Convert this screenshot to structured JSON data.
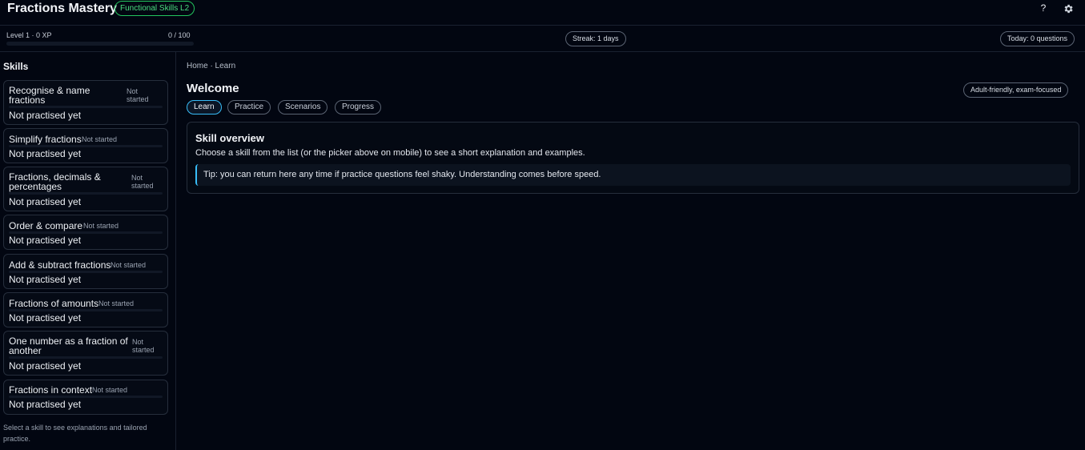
{
  "header": {
    "title": "Fractions Mastery",
    "badge": "Functional Skills L2",
    "help_glyph": "?",
    "help_icon": "help-icon",
    "settings_icon": "gear-icon"
  },
  "status": {
    "level_text": "Level 1 · 0 XP",
    "xp_text": "0 / 100",
    "xp_progress": 0,
    "streak": "Streak: 1 days",
    "today": "Today: 0 questions"
  },
  "sidebar": {
    "heading": "Skills",
    "skills": [
      {
        "name_lines": [
          "Recognise & name",
          "fractions"
        ],
        "status_lines": [
          "Not",
          "started"
        ],
        "practised": "Not practised yet",
        "progress": 0
      },
      {
        "name_lines": [
          "Simplify fractions"
        ],
        "status_lines": [
          "Not started"
        ],
        "practised": "Not practised yet",
        "progress": 0
      },
      {
        "name_lines": [
          "Fractions, decimals &",
          "percentages"
        ],
        "status_lines": [
          "Not",
          "started"
        ],
        "practised": "Not practised yet",
        "progress": 0
      },
      {
        "name_lines": [
          "Order & compare"
        ],
        "status_lines": [
          "Not started"
        ],
        "practised": "Not practised yet",
        "progress": 0
      },
      {
        "name_lines": [
          "Add & subtract fractions"
        ],
        "status_lines": [
          "Not started"
        ],
        "practised": "Not practised yet",
        "progress": 0
      },
      {
        "name_lines": [
          "Fractions of amounts"
        ],
        "status_lines": [
          "Not started"
        ],
        "practised": "Not practised yet",
        "progress": 0
      },
      {
        "name_lines": [
          "One number as a fraction of",
          "another"
        ],
        "status_lines": [
          "Not",
          "started"
        ],
        "practised": "Not practised yet",
        "progress": 0
      },
      {
        "name_lines": [
          "Fractions in context"
        ],
        "status_lines": [
          "Not started"
        ],
        "practised": "Not practised yet",
        "progress": 0
      }
    ],
    "hint": "Select a skill to see explanations and tailored practice."
  },
  "main": {
    "breadcrumb": "Home · Learn",
    "title": "Welcome",
    "tag": "Adult-friendly, exam-focused",
    "tabs": [
      "Learn",
      "Practice",
      "Scenarios",
      "Progress"
    ],
    "active_tab": "Learn",
    "overview": {
      "title": "Skill overview",
      "text": "Choose a skill from the list (or the picker above on mobile) to see a short explanation and examples.",
      "tip": "Tip: you can return here any time if practice questions feel shaky. Understanding comes before speed."
    }
  },
  "colors": {
    "accent": "#38bdf8",
    "badge": "#22c55e",
    "background": "#020611"
  }
}
